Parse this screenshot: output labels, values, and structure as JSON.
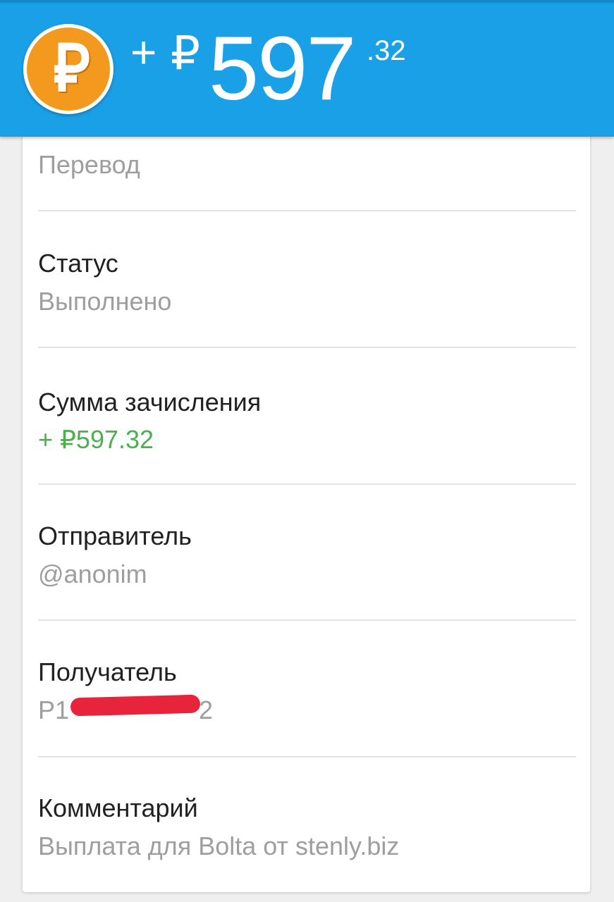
{
  "header": {
    "sign": "+",
    "currency_symbol": "₽",
    "amount_main": "597",
    "amount_cents": ".32",
    "coin_icon": "ruble-coin-icon",
    "background_color": "#1aa0e6",
    "coin_color": "#f39a1e"
  },
  "details": [
    {
      "label": "",
      "value": "Перевод"
    },
    {
      "label": "Статус",
      "value": "Выполнено"
    },
    {
      "label": "Сумма зачисления",
      "value": "+ ₽597.32",
      "value_color": "#4caf50"
    },
    {
      "label": "Отправитель",
      "value": "@anonim"
    },
    {
      "label": "Получатель",
      "value": "P1",
      "value_suffix": "2",
      "redacted": true
    },
    {
      "label": "Комментарий",
      "value": "Выплата для Bolta от stenly.biz"
    }
  ]
}
